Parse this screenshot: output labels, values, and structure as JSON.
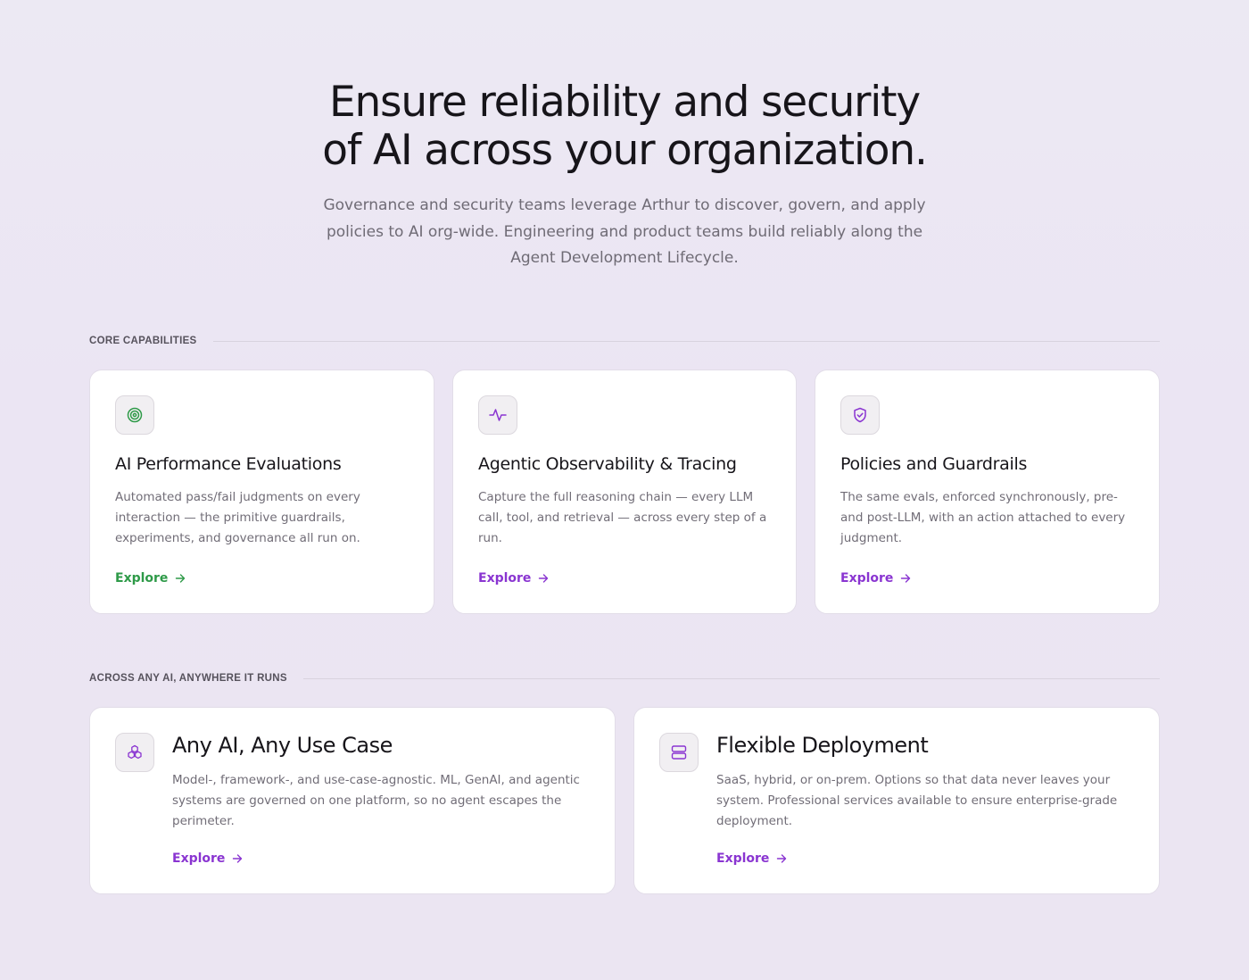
{
  "hero": {
    "title_line1": "Ensure reliability and security",
    "title_line2": "of AI across your organization.",
    "subtitle": "Governance and security teams leverage Arthur to discover, govern, and apply policies to AI org-wide. Engineering and product teams build reliably along the Agent Development Lifecycle."
  },
  "sections": {
    "core": {
      "label": "CORE CAPABILITIES",
      "cards": [
        {
          "icon": "target-icon",
          "title": "AI Performance Evaluations",
          "description": "Automated pass/fail judgments on every interaction — the primitive guardrails, experiments, and governance all run on.",
          "cta": "Explore",
          "accent": "#2e9a48"
        },
        {
          "icon": "activity-pulse-icon",
          "title": "Agentic Observability & Tracing",
          "description": "Capture the full reasoning chain — every LLM call, tool, and retrieval — across every step of a run.",
          "cta": "Explore",
          "accent": "#8a35d1"
        },
        {
          "icon": "shield-check-icon",
          "title": "Policies and Guardrails",
          "description": "The same evals, enforced synchronously, pre- and post-LLM, with an action attached to every judgment.",
          "cta": "Explore",
          "accent": "#8a35d1"
        }
      ]
    },
    "anywhere": {
      "label": "ACROSS ANY AI, ANYWHERE IT RUNS",
      "cards": [
        {
          "icon": "cubes-icon",
          "title": "Any AI, Any Use Case",
          "description": "Model-, framework-, and use-case-agnostic. ML, GenAI, and agentic systems are governed on one platform, so no agent escapes the perimeter.",
          "cta": "Explore",
          "accent": "#8a35d1"
        },
        {
          "icon": "server-icon",
          "title": "Flexible Deployment",
          "description": "SaaS, hybrid, or on-prem. Options so that data never leaves your system. Professional services available to ensure enterprise-grade deployment.",
          "cta": "Explore",
          "accent": "#8a35d1"
        }
      ]
    }
  }
}
